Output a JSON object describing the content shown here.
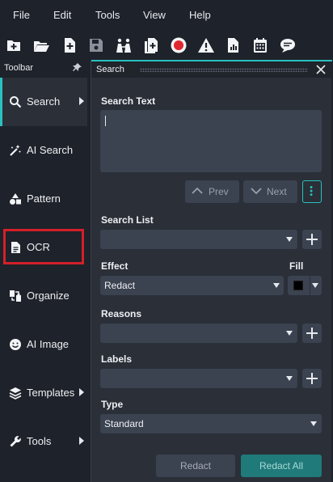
{
  "menu": [
    "File",
    "Edit",
    "Tools",
    "View",
    "Help"
  ],
  "toolbar_icons": [
    "new-document-icon",
    "open-folder-icon",
    "add-page-icon",
    "save-icon",
    "compare-icon",
    "copy-add-icon",
    "record-icon",
    "warning-icon",
    "report-chart-icon",
    "calendar-icon",
    "comment-icon"
  ],
  "left_panel": {
    "title": "Toolbar",
    "items": [
      {
        "label": "Search",
        "icon": "search-icon",
        "arrow": true,
        "active": true
      },
      {
        "label": "AI Search",
        "icon": "magic-wand-icon",
        "arrow": false
      },
      {
        "label": "Pattern",
        "icon": "shapes-icon",
        "arrow": false
      },
      {
        "label": "OCR",
        "icon": "document-icon",
        "arrow": false
      },
      {
        "label": "Organize",
        "icon": "organize-pages-icon",
        "arrow": false
      },
      {
        "label": "AI Image",
        "icon": "smiley-icon",
        "arrow": false
      },
      {
        "label": "Templates",
        "icon": "layers-icon",
        "arrow": true
      },
      {
        "label": "Tools",
        "icon": "wrench-icon",
        "arrow": true
      }
    ]
  },
  "search_panel": {
    "title": "Search",
    "search_text_label": "Search Text",
    "search_text_value": "",
    "prev_label": "Prev",
    "next_label": "Next",
    "search_list_label": "Search List",
    "search_list_value": "",
    "effect_label": "Effect",
    "effect_value": "Redact",
    "fill_label": "Fill",
    "fill_color": "#000000",
    "reasons_label": "Reasons",
    "reasons_value": "",
    "labels_label": "Labels",
    "labels_value": "",
    "type_label": "Type",
    "type_value": "Standard",
    "redact_label": "Redact",
    "redact_all_label": "Redact All"
  },
  "colors": {
    "accent": "#2bc0bf",
    "highlight": "#d3202a",
    "primary_button": "#1f7a79"
  }
}
